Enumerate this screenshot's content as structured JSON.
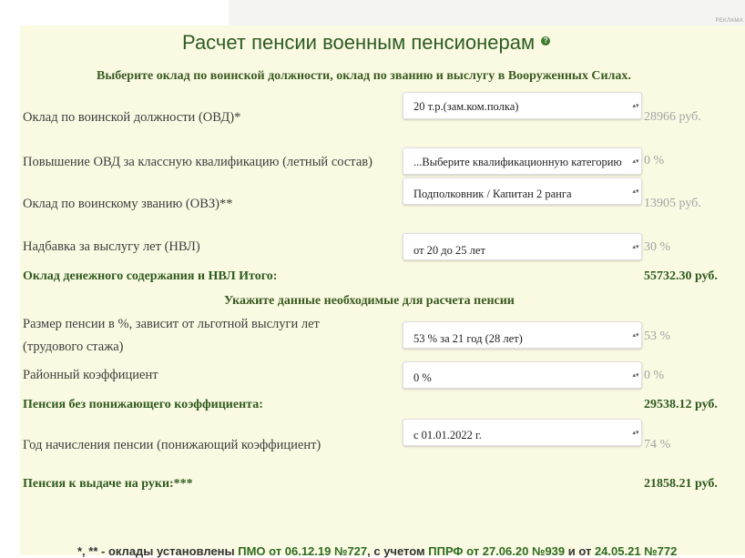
{
  "ad_label": "РЕКЛАМА",
  "title": "Расчет пенсии военным пенсионерам",
  "help_glyph": "?",
  "subheading_1": "Выберите оклад по воинской должности, оклад по званию и выслугу в Вооруженных Силах.",
  "rows": [
    {
      "label": "Оклад по воинской должности (ОВД)*",
      "selected": "20 т.р.(зам.ком.полка)",
      "value": "28966 руб."
    },
    {
      "label": "Повышение ОВД за классную квалификацию (летный состав)",
      "selected": "...Выберите квалификационную категорию",
      "value": "0 %"
    },
    {
      "label": "Оклад по воинскому званию (ОВЗ)**",
      "selected": "Подполковник / Капитан 2 ранга",
      "value": "13905 руб."
    },
    {
      "label": "Надбавка за выслугу лет (НВЛ)",
      "selected": "от 20 до 25 лет",
      "value": "30 %"
    }
  ],
  "total_1": {
    "label": "Оклад денежного содержания и НВЛ Итого:",
    "value": "55732.30 руб."
  },
  "subheading_2": "Укажите данные необходимые для расчета пенсии",
  "rows2": [
    {
      "label_line1": "Размер пенсии в %, зависит от льготной выслуги лет",
      "label_line2": "(трудового стажа)",
      "selected": "53 % за 21 год (28 лет)",
      "value": "53 %"
    },
    {
      "label": "Районный коэффициент",
      "selected": "0 %",
      "value": "0 %"
    }
  ],
  "total_2": {
    "label": "Пенсия без понижающего коэффициента:",
    "value": "29538.12 руб."
  },
  "row_year": {
    "label": "Год начисления пенсии (понижающий коэффициент)",
    "selected": "с 01.01.2022 г.",
    "value": "74 %"
  },
  "total_3": {
    "label": "Пенсия к выдаче на руки:***",
    "value": "21858.21 руб."
  },
  "footnote": {
    "prefix": "*, ** - оклады установлены ",
    "link1": "ПМО от 06.12.19 №727",
    "mid1": ", с учетом ",
    "link2": "ППРФ от 27.06.20 №939",
    "mid2": " и от ",
    "link3": "24.05.21 №772"
  },
  "colors": {
    "panel_bg": "#fafae3",
    "title": "#2e5b22",
    "bold_green": "#2f5a1e",
    "value_grey": "#a2a2a2"
  },
  "icons": {
    "dropdown": "updown-arrows-icon",
    "help": "help-icon"
  }
}
